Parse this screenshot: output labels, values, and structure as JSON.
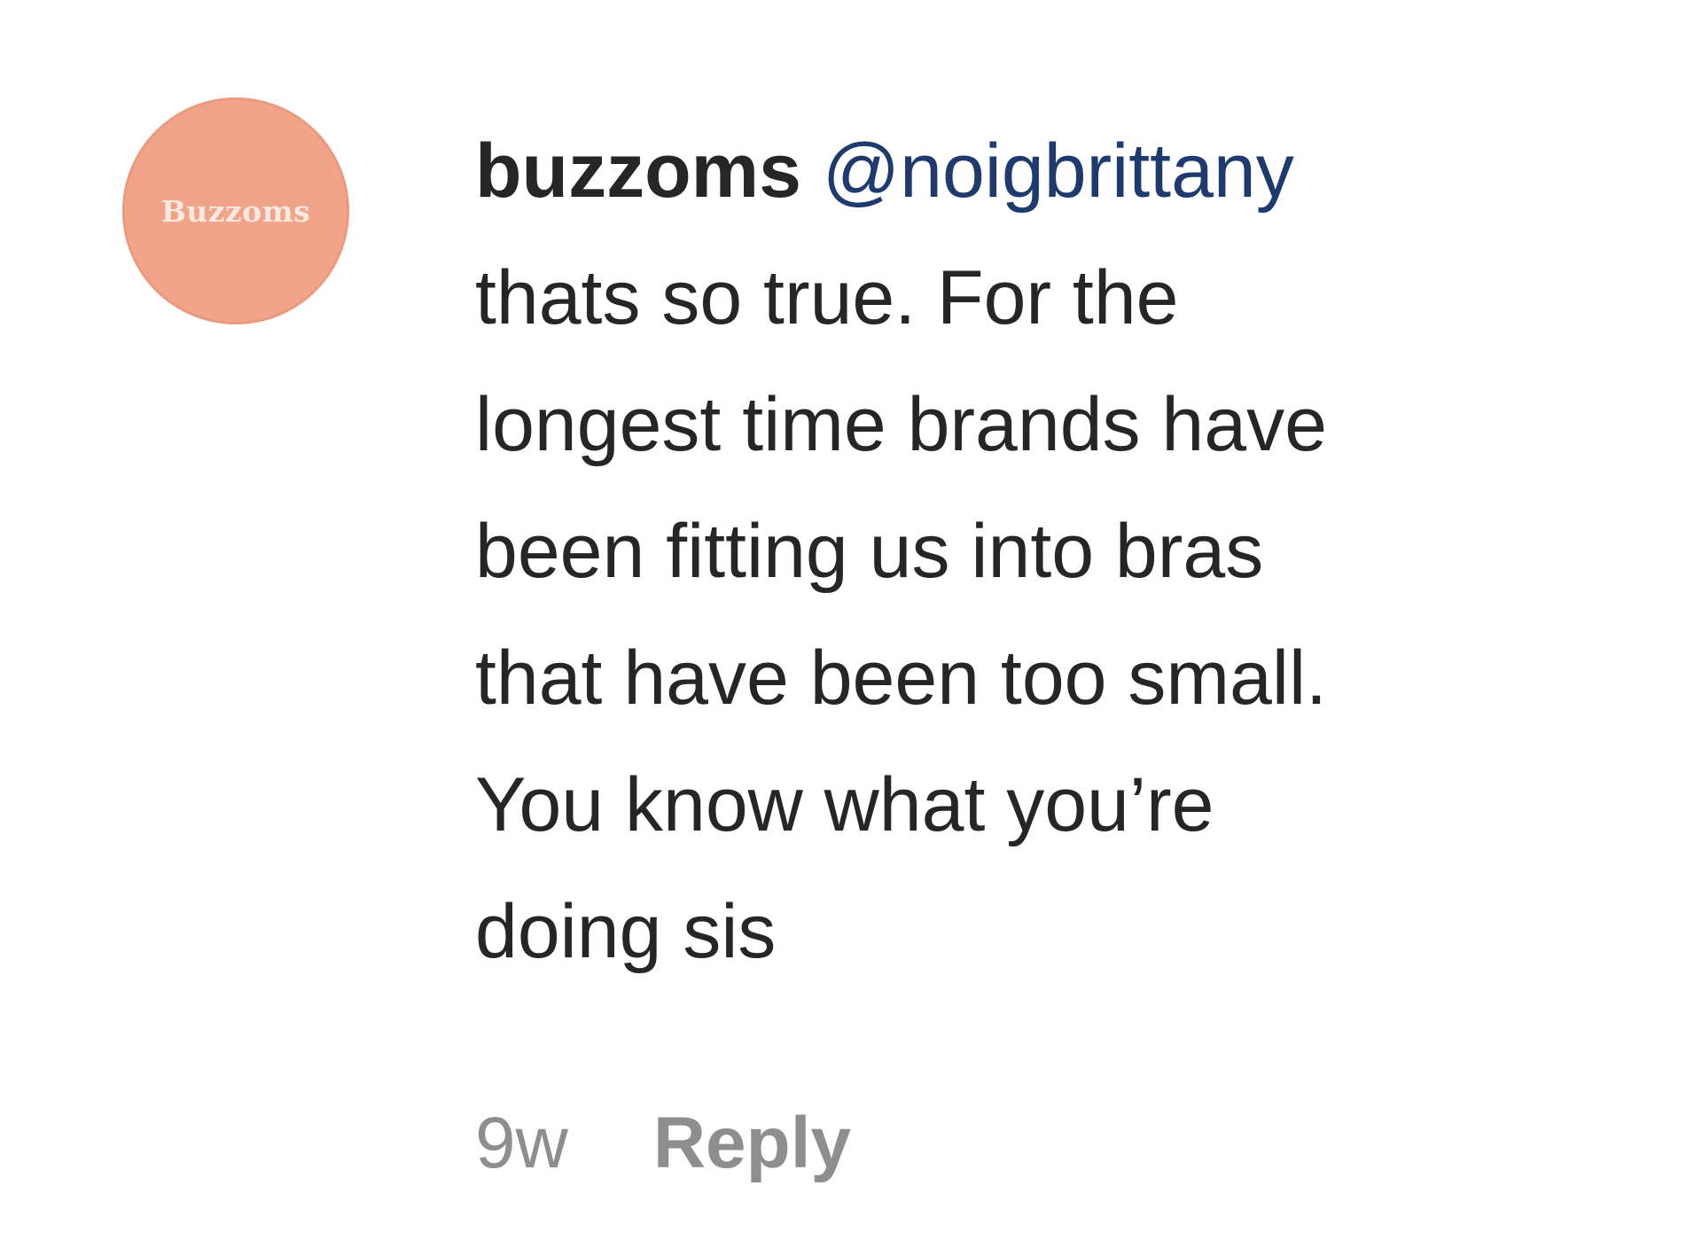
{
  "comment": {
    "avatar_label": "Buzzoms",
    "username": "buzzoms",
    "mention": "@noigbrittany",
    "text_lines": [
      "thats so true. For the",
      "longest time brands have",
      "been fitting us into bras",
      "that have been too small.",
      "You know what you’re",
      "doing sis"
    ],
    "timestamp": "9w",
    "reply_label": "Reply"
  },
  "colors": {
    "avatar_bg": "#f2a489",
    "mention": "#1e3a6e",
    "text": "#262626",
    "meta": "#8e8e8e"
  }
}
